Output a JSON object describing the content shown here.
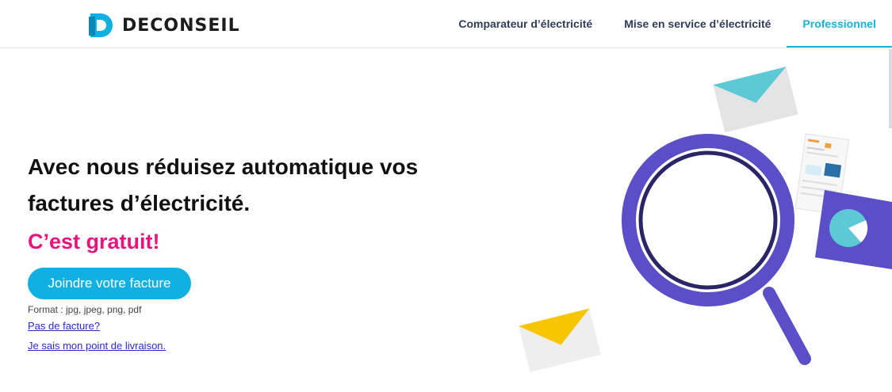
{
  "header": {
    "logo_text": "DECONSEIL",
    "nav": [
      {
        "label": "Comparateur d’électricité"
      },
      {
        "label": "Mise en service d’électricité"
      },
      {
        "label": "Professionnel",
        "active": true
      }
    ]
  },
  "hero": {
    "headline_line1": "Avec nous réduisez automatique vos",
    "headline_line2": "factures d’électricité.",
    "free_text": "C’est gratuit!",
    "cta_label": "Joindre votre facture",
    "format_text": "Format : jpg, jpeg, png, pdf",
    "link_no_invoice": "Pas de facture?",
    "link_delivery_point": "Je sais mon point de livraison."
  },
  "colors": {
    "brand_blue": "#11b0e3",
    "accent_pink": "#e8137c",
    "nav_text": "#2f3d5a",
    "nav_active": "#1bb1d9",
    "magnifier_purple": "#5b4fc7",
    "envelope_teal": "#5ec9d6",
    "envelope_yellow": "#f7c600"
  },
  "icons": [
    "logo-d-icon",
    "magnifier-illustration",
    "envelope-teal-icon",
    "envelope-yellow-icon",
    "invoice-document-icon",
    "pie-chart-card-icon"
  ]
}
